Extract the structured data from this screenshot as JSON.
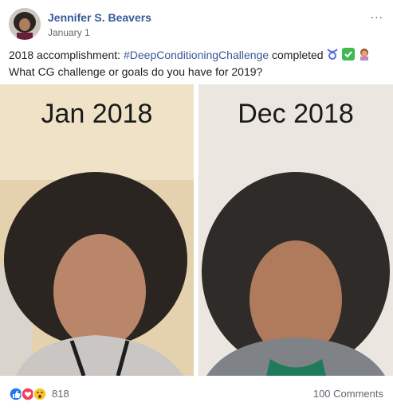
{
  "post": {
    "author": "Jennifer S. Beavers",
    "date": "January 1",
    "more_label": "...",
    "text_line1_prefix": "2018 accomplishment: ",
    "hashtag": "#DeepConditioningChallenge",
    "text_line1_suffix": " completed",
    "text_line2": "What CG challenge or goals do you have for 2019?",
    "emoji_icons": [
      "taurus-icon",
      "check-mark-icon",
      "woman-gesturing-icon"
    ]
  },
  "photos": [
    {
      "label": "Jan 2018"
    },
    {
      "label": "Dec 2018"
    }
  ],
  "footer": {
    "reaction_icons": [
      "like-icon",
      "love-icon",
      "wow-icon"
    ],
    "reaction_count": "818",
    "comments": "100 Comments"
  }
}
